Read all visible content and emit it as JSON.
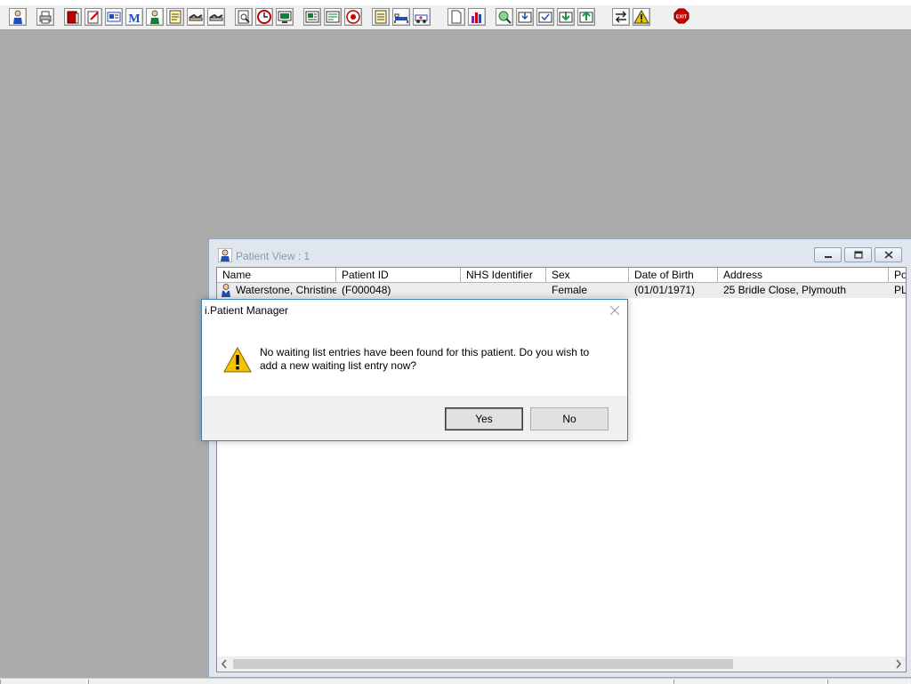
{
  "toolbar": {
    "buttons": [
      {
        "icon": "patient-icon",
        "color": "#1f4fb5"
      },
      {
        "icon": "printer-icon",
        "color": "#444444"
      },
      {
        "icon": "red-book-icon",
        "color": "#c00000"
      },
      {
        "icon": "edit-notes-icon",
        "color": "#444444"
      },
      {
        "icon": "record-card-icon",
        "color": "#1f4fb5"
      },
      {
        "icon": "letter-m-icon",
        "color": "#1f4fb5"
      },
      {
        "icon": "doctor-icon",
        "color": "#1a7a3a"
      },
      {
        "icon": "notepad-icon",
        "color": "#c9a400"
      },
      {
        "icon": "handshake-icon",
        "color": "#333333"
      },
      {
        "icon": "handshake-alt-icon",
        "color": "#333333"
      },
      {
        "icon": "search-document-icon",
        "color": "#444444"
      },
      {
        "icon": "clock-icon",
        "color": "#c00000"
      },
      {
        "icon": "monitor-icon",
        "color": "#1a7a3a"
      },
      {
        "icon": "image-report-icon",
        "color": "#1a7a3a"
      },
      {
        "icon": "form-icon",
        "color": "#1a7a3a"
      },
      {
        "icon": "target-icon",
        "color": "#c00000"
      },
      {
        "icon": "list-icon",
        "color": "#c9a400"
      },
      {
        "icon": "bed-icon",
        "color": "#1f4fb5"
      },
      {
        "icon": "ambulance-icon",
        "color": "#1f4fb5"
      },
      {
        "icon": "page-icon",
        "color": "#444444"
      },
      {
        "icon": "bar-chart-icon",
        "color": "#7a2aa8"
      },
      {
        "icon": "globe-search-icon",
        "color": "#1a7a3a"
      },
      {
        "icon": "inbox-down-icon",
        "color": "#1f4fb5"
      },
      {
        "icon": "inbox-check-icon",
        "color": "#1f4fb5"
      },
      {
        "icon": "inbox-green-icon",
        "color": "#1a9a3a"
      },
      {
        "icon": "outbox-green-icon",
        "color": "#1a9a3a"
      },
      {
        "icon": "transfer-arrows-icon",
        "color": "#222222"
      },
      {
        "icon": "warning-icon",
        "color": "#e8c400"
      },
      {
        "icon": "exit-icon",
        "color": "#d40000"
      }
    ]
  },
  "patient_view": {
    "title": "Patient View : 1",
    "columns": [
      "Name",
      "Patient ID",
      "NHS Identifier",
      "Sex",
      "Date of Birth",
      "Address",
      "Po"
    ],
    "rows": [
      {
        "name": "Waterstone, Christine...",
        "patient_id": "(F000048)",
        "nhs": "",
        "sex": "Female",
        "dob": "(01/01/1971)",
        "address": "25 Bridle Close, Plymouth",
        "post": "PL"
      }
    ]
  },
  "dialog": {
    "title": "i.Patient Manager",
    "message": "No waiting list entries have been found for this patient. Do you wish to add a new waiting list entry now?",
    "yes_label": "Yes",
    "no_label": "No"
  },
  "colors": {
    "desktop": "#ababab",
    "dialog_border": "#3c7fb1",
    "window_frame": "#dfe6ee"
  }
}
